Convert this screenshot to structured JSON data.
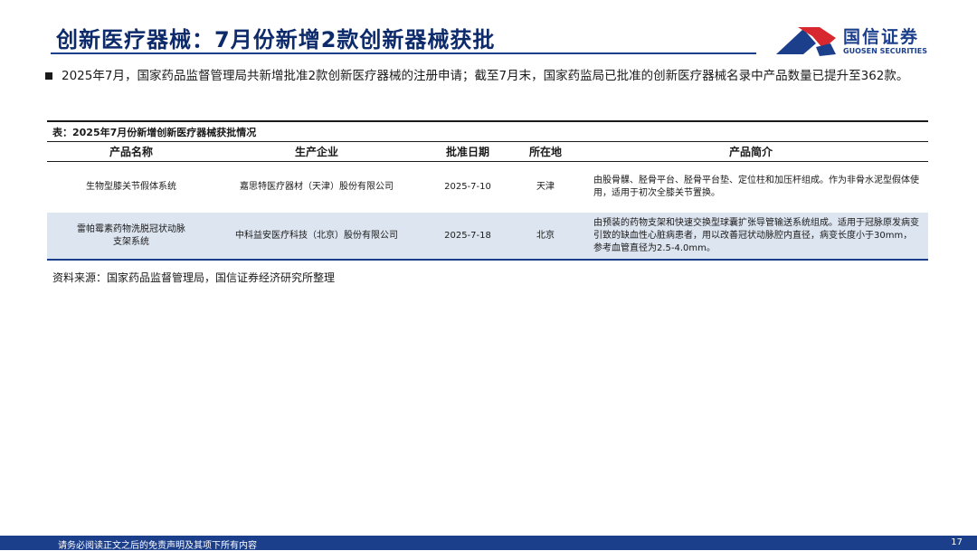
{
  "header": {
    "title": "创新医疗器械：7月份新增2款创新器械获批",
    "logo_cn": "国信证券",
    "logo_en": "GUOSEN SECURITIES"
  },
  "bullet": {
    "text": "2025年7月，国家药品监督管理局共新增批准2款创新医疗器械的注册申请；截至7月末，国家药监局已批准的创新医疗器械名录中产品数量已提升至362款。"
  },
  "table": {
    "caption": "表：2025年7月份新增创新医疗器械获批情况",
    "columns": [
      "产品名称",
      "生产企业",
      "批准日期",
      "所在地",
      "产品简介"
    ],
    "rows": [
      {
        "name": "生物型膝关节假体系统",
        "company": "嘉思特医疗器材（天津）股份有限公司",
        "date": "2025-7-10",
        "location": "天津",
        "description": "由股骨髁、胫骨平台、胫骨平台垫、定位柱和加压杆组成。作为非骨水泥型假体使用，适用于初次全膝关节置换。"
      },
      {
        "name_line1": "雷帕霉素药物洗脱冠状动脉",
        "name_line2": "支架系统",
        "company": "中科益安医疗科技（北京）股份有限公司",
        "date": "2025-7-18",
        "location": "北京",
        "description": "由预装的药物支架和快速交换型球囊扩张导管输送系统组成。适用于冠脉原发病变引致的缺血性心脏病患者，用以改善冠状动脉腔内直径，病变长度小于30mm，参考血管直径为2.5-4.0mm。"
      }
    ]
  },
  "source": "资料来源：国家药品监督管理局，国信证券经济研究所整理",
  "footer": {
    "disclaimer": "请务必阅读正文之后的免责声明及其项下所有内容",
    "page_number": "17"
  },
  "colors": {
    "brand_blue": "#1c3f8c",
    "brand_red": "#d7282f",
    "title_navy": "#0d2a6b",
    "row_highlight": "#dde5f0"
  }
}
